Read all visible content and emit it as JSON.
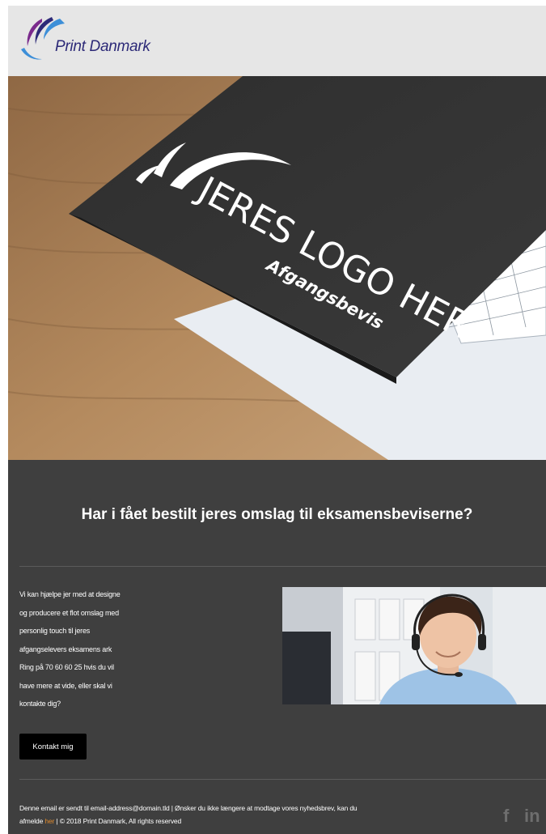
{
  "header": {
    "brand_name": "Print Danmark",
    "logo_icon": "print-danmark-swoosh-icon"
  },
  "hero": {
    "cover_logo_text": "JERES LOGO HER",
    "cover_subtitle": "Afgangsbevis"
  },
  "headline": "Har i fået bestilt jeres omslag til eksamensbeviserne?",
  "body_lines": [
    "Vi kan hjælpe jer med at designe",
    "og producere et flot omslag med",
    "personlig touch til jeres",
    "afgangselevers eksamens ark",
    "Ring på 70 60 60 25 hvis du vil",
    "have mere at vide, eller skal vi",
    "kontakte dig?"
  ],
  "cta_label": "Kontakt mig",
  "footer": {
    "line1": "Denne email er sendt til email-address@domain.tld  |  Ønsker du ikke længere at modtage vores nyhedsbrev, kan du",
    "line2_prefix": "afmelde ",
    "unsubscribe_link": "her",
    "line2_suffix": "  |  © 2018 Print Danmark, All rights reserved"
  },
  "social": {
    "facebook": "f",
    "linkedin": "in"
  },
  "colors": {
    "header_bg": "#e6e6e6",
    "body_bg": "#3f3f3f",
    "brand_navy": "#2d2a78",
    "link_orange": "#e08a2c",
    "button_bg": "#000000"
  }
}
